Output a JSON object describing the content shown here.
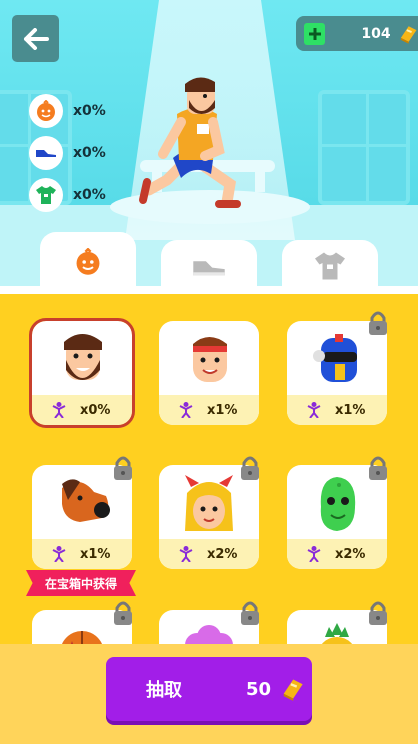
{
  "header": {
    "back_icon": "arrow-left-icon",
    "currency": {
      "plus_icon": "plus-icon",
      "amount": "104",
      "currency_icon": "gold-bar-icon"
    }
  },
  "stats": [
    {
      "icon": "face-icon",
      "value": "x0%"
    },
    {
      "icon": "shoe-icon",
      "value": "x0%"
    },
    {
      "icon": "shirt-icon",
      "value": "x0%"
    }
  ],
  "tabs": [
    {
      "icon": "face-icon",
      "active": true
    },
    {
      "icon": "shoe-icon",
      "active": false
    },
    {
      "icon": "shirt-icon",
      "active": false
    }
  ],
  "items": [
    {
      "character": "bearded-man",
      "bonus": "x0%",
      "locked": false,
      "selected": true
    },
    {
      "character": "headband-man",
      "bonus": "x1%",
      "locked": false,
      "selected": false
    },
    {
      "character": "robot-helmet",
      "bonus": "x1%",
      "locked": true,
      "selected": false
    },
    {
      "character": "horse-head",
      "bonus": "x1%",
      "locked": true,
      "selected": false
    },
    {
      "character": "devil-girl",
      "bonus": "x2%",
      "locked": true,
      "selected": false
    },
    {
      "character": "green-alien",
      "bonus": "x2%",
      "locked": true,
      "selected": false
    },
    {
      "character": "basketball-head",
      "locked": true
    },
    {
      "character": "pink-hair",
      "locked": true
    },
    {
      "character": "pineapple-head",
      "locked": true
    }
  ],
  "ribbon_text": "在宝箱中获得",
  "draw_button": {
    "label": "抽取",
    "cost": "50",
    "currency_icon": "gold-bar-icon"
  },
  "colors": {
    "accent": "#a21ee8",
    "background": "#ffd020",
    "scene": "#5fe3ee",
    "ribbon": "#f0205c"
  }
}
